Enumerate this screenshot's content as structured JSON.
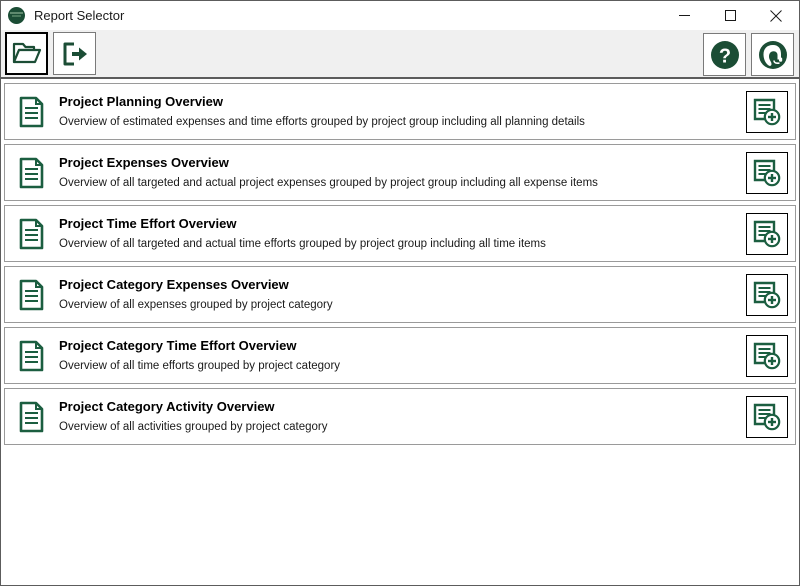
{
  "window": {
    "title": "Report Selector",
    "logo_icon": "app-logo-icon",
    "caption": {
      "minimize": "minimize-icon",
      "maximize": "maximize-icon",
      "close": "close-icon"
    }
  },
  "toolbar": {
    "open_label": "open-folder-icon",
    "exit_label": "exit-icon",
    "help_label": "help-icon",
    "support_label": "support-headset-icon"
  },
  "colors": {
    "accent_green": "#1b4d35",
    "toolbar_bg": "#f0f0f0",
    "border": "#9a9a9a",
    "window_border": "#5c5c5c"
  },
  "reports": [
    {
      "title": "Project Planning Overview",
      "description": "Overview of estimated expenses and time efforts grouped by project group including all planning details",
      "icon": "report-document-icon",
      "action_icon": "add-report-icon"
    },
    {
      "title": "Project Expenses Overview",
      "description": "Overview of all targeted and actual project expenses grouped by project group including all expense items",
      "icon": "report-document-icon",
      "action_icon": "add-report-icon"
    },
    {
      "title": "Project Time Effort Overview",
      "description": "Overview of all targeted and actual time efforts grouped by project group including all time items",
      "icon": "report-document-icon",
      "action_icon": "add-report-icon"
    },
    {
      "title": "Project Category Expenses Overview",
      "description": "Overview of all expenses grouped by project category",
      "icon": "report-document-icon",
      "action_icon": "add-report-icon"
    },
    {
      "title": "Project Category Time Effort Overview",
      "description": "Overview of all time efforts grouped by project category",
      "icon": "report-document-icon",
      "action_icon": "add-report-icon"
    },
    {
      "title": "Project Category Activity Overview",
      "description": "Overview of all activities grouped by project category",
      "icon": "report-document-icon",
      "action_icon": "add-report-icon"
    }
  ]
}
